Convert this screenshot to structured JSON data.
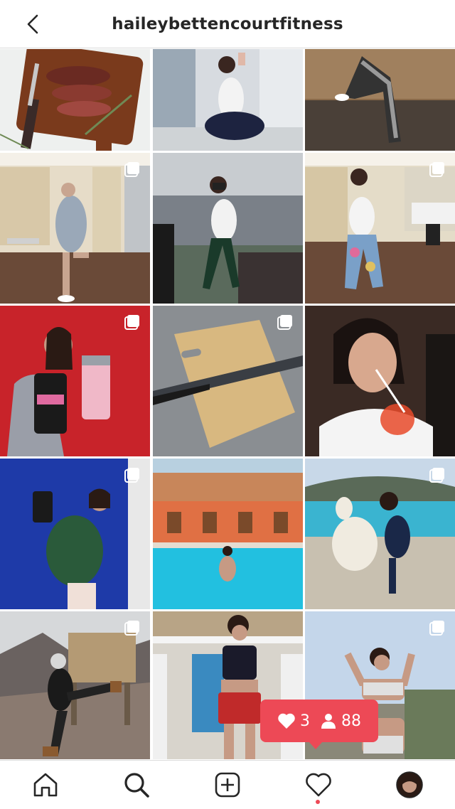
{
  "header": {
    "username": "haileybettencourtfitness",
    "back_icon": "chevron-left-icon"
  },
  "grid": {
    "posts": [
      {
        "id": "steak-board",
        "multi": false
      },
      {
        "id": "gym-mirror-selfie-white-top",
        "multi": false
      },
      {
        "id": "leggings-step-pose",
        "multi": false
      },
      {
        "id": "locker-room-hoodie",
        "multi": true
      },
      {
        "id": "gym-floor-mask-selfie",
        "multi": false
      },
      {
        "id": "locker-room-tie-dye",
        "multi": true
      },
      {
        "id": "protein-tub-shaker",
        "multi": true
      },
      {
        "id": "knife-cutting-board",
        "multi": true
      },
      {
        "id": "drink-straw-smile",
        "multi": false
      },
      {
        "id": "blue-wall-protein",
        "multi": true
      },
      {
        "id": "hotel-pool",
        "multi": false
      },
      {
        "id": "alpaca-lake",
        "multi": true
      },
      {
        "id": "snowy-mountain-sign",
        "multi": true
      },
      {
        "id": "patio-red-shorts",
        "multi": false
      },
      {
        "id": "beach-bikini",
        "multi": true
      }
    ]
  },
  "notification": {
    "likes_count": "3",
    "followers_count": "88",
    "color": "#ed4956"
  },
  "tabbar": {
    "items": [
      "home-icon",
      "search-icon",
      "new-post-icon",
      "activity-heart-icon",
      "profile-avatar"
    ]
  }
}
